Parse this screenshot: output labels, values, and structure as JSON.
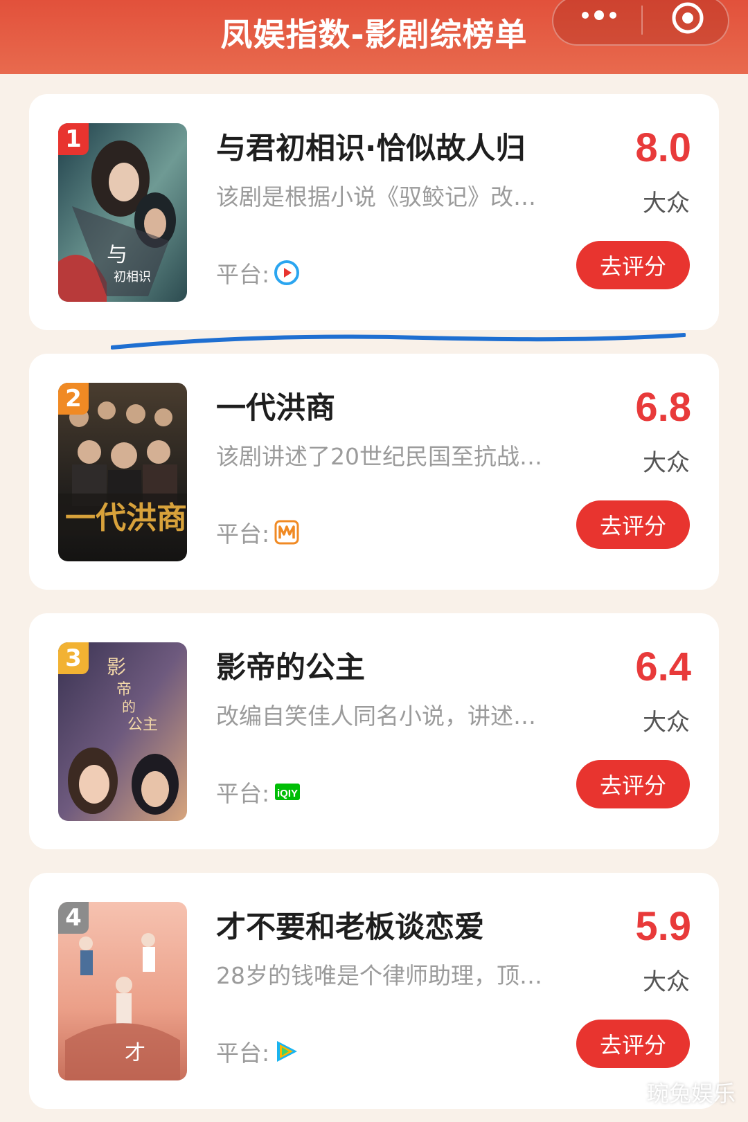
{
  "header": {
    "title": "凤娱指数-影剧综榜单",
    "more_icon": "more-dots-icon",
    "target_icon": "target-circle-icon",
    "bg_color": "#e2513b"
  },
  "items": [
    {
      "rank": "1",
      "rank_color": "#e8342f",
      "title": "与君初相识·恰似故人归",
      "desc": "该剧是根据小说《驭鲛记》改…",
      "platform_label": "平台:",
      "platform_icon": "youku-icon",
      "score": "8.0",
      "score_tag": "大众",
      "button": "去评分",
      "poster_colors": [
        "#2e5560",
        "#8ab0a8",
        "#c3423c"
      ]
    },
    {
      "rank": "2",
      "rank_color": "#f08a24",
      "title": "一代洪商",
      "desc": "该剧讲述了20世纪民国至抗战…",
      "platform_label": "平台:",
      "platform_icon": "mgtv-icon",
      "score": "6.8",
      "score_tag": "大众",
      "button": "去评分",
      "poster_colors": [
        "#2a2724",
        "#6b5a44",
        "#c9962e"
      ]
    },
    {
      "rank": "3",
      "rank_color": "#f2b233",
      "title": "影帝的公主",
      "desc": "改编自笑佳人同名小说，讲述…",
      "platform_label": "平台:",
      "platform_icon": "iqiyi-icon",
      "score": "6.4",
      "score_tag": "大众",
      "button": "去评分",
      "poster_colors": [
        "#3b3450",
        "#7e6a86",
        "#c59a74"
      ]
    },
    {
      "rank": "4",
      "rank_color": "#8c8c8c",
      "title": "才不要和老板谈恋爱",
      "desc": "28岁的钱唯是个律师助理，顶…",
      "platform_label": "平台:",
      "platform_icon": "tencent-video-icon",
      "score": "5.9",
      "score_tag": "大众",
      "button": "去评分",
      "poster_colors": [
        "#f2b7a2",
        "#e58d78",
        "#c06a5a"
      ]
    }
  ],
  "watermark": "琬兔娱乐"
}
